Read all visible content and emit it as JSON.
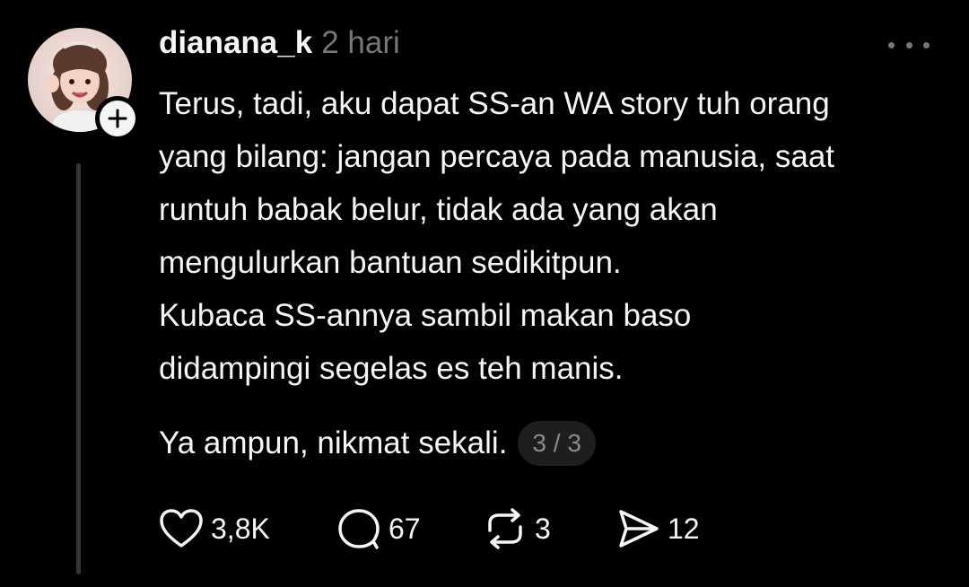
{
  "post": {
    "username": "dianana_k",
    "time": "2 hari",
    "lines": [
      "Terus, tadi, aku dapat SS-an WA story tuh orang",
      "yang bilang: jangan percaya pada manusia, saat",
      "runtuh babak belur, tidak ada yang akan",
      "mengulurkan bantuan sedikitpun.",
      "Kubaca SS-annya sambil makan baso",
      "didampingi segelas es teh manis."
    ],
    "last_line": "Ya ampun, nikmat sekali.",
    "pager": "3 / 3"
  },
  "actions": {
    "likes": "3,8K",
    "replies": "67",
    "reposts": "3",
    "shares": "12"
  },
  "icons": {
    "avatar": "avatar-image",
    "follow": "plus-icon",
    "more": "more-dots-icon",
    "like": "heart-icon",
    "reply": "comment-bubble-icon",
    "repost": "repost-icon",
    "share": "send-icon"
  },
  "colors": {
    "background": "#000000",
    "text": "#f3f5f7",
    "muted": "#777777",
    "pill": "#1e1e1e"
  }
}
